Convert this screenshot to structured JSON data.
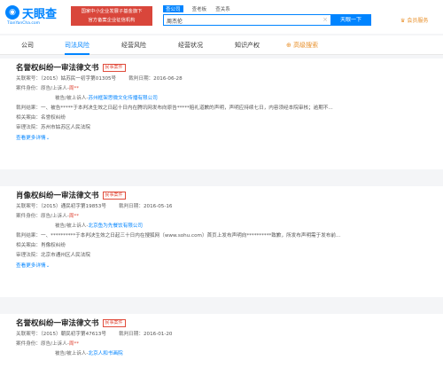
{
  "header": {
    "logo_text": "天眼查",
    "logo_sub": "TianYanCha.com",
    "banner_line1": "国家中小企业发展子基金旗下",
    "banner_line2": "官方备案企业征信机构",
    "search_tabs": [
      "查公司",
      "查老板",
      "查关系"
    ],
    "search_value": "周杰伦",
    "search_button": "天眼一下",
    "member": "会员服务"
  },
  "nav": {
    "items": [
      "公司",
      "司法风险",
      "经营风险",
      "经营状况",
      "知识产权"
    ],
    "advanced": "高级搜索"
  },
  "cards": [
    {
      "title": "名誉权纠纷一审法律文书",
      "tag": "民事案件",
      "case_label": "关联案号：",
      "case_no": "（2015）姑苏民一初字第01305号",
      "date_label": "裁判日期：",
      "date": "2016-06-28",
      "party_label": "案件身份：",
      "party1_prefix": "原告/上诉人-",
      "party1_name": "周**",
      "party2_prefix": "被告/被上诉人-",
      "party2_name": "苏州框架思微文化传播有限公司",
      "result_label": "裁判结果：",
      "result": "一、被告*****于本判决生效之日起十日内在腾讯网发布向原告*****赔礼道歉的声明，声明应持续七日，内容须经本院审核；逾期不...",
      "cause_label": "相关案由：",
      "cause": "名誉权纠纷",
      "court_label": "审理法院：",
      "court": "苏州市姑苏区人民法院",
      "more": "查看更多详情"
    },
    {
      "title": "肖像权纠纷一审法律文书",
      "tag": "民事案件",
      "case_label": "关联案号：",
      "case_no": "（2015）通民初字第19853号",
      "date_label": "裁判日期：",
      "date": "2016-05-16",
      "party_label": "案件身份：",
      "party1_prefix": "原告/上诉人-",
      "party1_name": "周**",
      "party2_prefix": "被告/被上诉人-",
      "party2_name": "北京鱼为先餐饮有限公司",
      "result_label": "裁判结果：",
      "result": "一、**********于本判决生效之日起三十日内在搜狐网（www.sohu.com）首页上发布声明向**********致歉，所发布声明需于发布前...",
      "cause_label": "相关案由：",
      "cause": "肖像权纠纷",
      "court_label": "审理法院：",
      "court": "北京市通州区人民法院",
      "more": "查看更多详情"
    },
    {
      "title": "名誉权纠纷一审法律文书",
      "tag": "民事案件",
      "case_label": "关联案号：",
      "case_no": "（2015）朝民初字第47613号",
      "date_label": "裁判日期：",
      "date": "2016-01-20",
      "party_label": "案件身份：",
      "party1_prefix": "原告/上诉人-",
      "party1_name": "周**",
      "party2_prefix": "被告/被上诉人-",
      "party2_name": "北京人和书画院"
    }
  ],
  "colors": {
    "primary": "#0084ff",
    "danger": "#e04b3b",
    "member": "#e8902b",
    "banner": "#d9463b"
  }
}
